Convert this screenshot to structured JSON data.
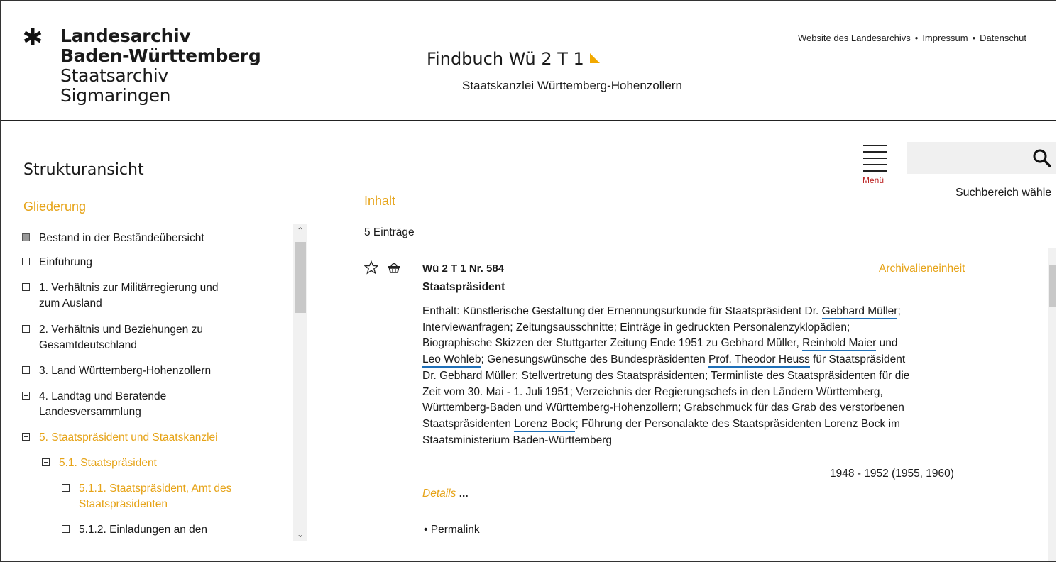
{
  "header": {
    "logo": {
      "line1": "Landesarchiv",
      "line2": "Baden-Württemberg",
      "line3": "Staatsarchiv",
      "line4": "Sigmaringen"
    },
    "title": "Findbuch Wü 2 T 1",
    "subtitle": "Staatskanzlei Württemberg-Hohenzollern",
    "links": [
      "Website des Landesarchivs",
      "Impressum",
      "Datenschut"
    ],
    "link_separator": "•"
  },
  "sidebar": {
    "heading": "Strukturansicht",
    "subheading": "Gliederung",
    "items": [
      {
        "label": "Bestand in der Beständeübersicht",
        "icon": "filled-square-icon"
      },
      {
        "label": "Einführung",
        "icon": "empty-square-icon"
      },
      {
        "label_lines": [
          "1. Verhältnis zur Militärregierung und",
          "zum Ausland"
        ],
        "icon": "expand-plus-icon"
      },
      {
        "label_lines": [
          "2. Verhältnis und Beziehungen zu",
          "Gesamtdeutschland"
        ],
        "icon": "expand-plus-icon"
      },
      {
        "label": "3. Land Württemberg-Hohenzollern",
        "icon": "expand-plus-icon"
      },
      {
        "label_lines": [
          "4. Landtag und Beratende",
          "Landesversammlung"
        ],
        "icon": "expand-plus-icon"
      },
      {
        "label": "5. Staatspräsident und Staatskanzlei",
        "icon": "collapse-minus-icon",
        "active": true
      },
      {
        "label": "5.1. Staatspräsident",
        "icon": "collapse-minus-icon",
        "active": true
      },
      {
        "label_lines": [
          "5.1.1. Staatspräsident, Amt des",
          "Staatspräsidenten"
        ],
        "icon": "empty-square-icon",
        "active": true
      },
      {
        "label": "5.1.2. Einladungen an den",
        "icon": "empty-square-icon"
      }
    ]
  },
  "toolbar": {
    "menu_label": "Menü",
    "search_placeholder": "",
    "search_scope": "Suchbereich wähle"
  },
  "content": {
    "heading": "Inhalt",
    "count": "5 Einträge",
    "entry": {
      "signature": "Wü 2 T 1 Nr. 584",
      "type": "Archivalieneinheit",
      "title": "Staatspräsident",
      "text_lines": [
        [
          "Enthält: Künstlerische Gestaltung der Ernennungsurkunde für Staatspräsident Dr. ",
          "Gebhard Müller",
          ";"
        ],
        [
          "Interviewanfragen; Zeitungsausschnitte; Einträge in gedruckten Personalenzyklopädien;"
        ],
        [
          "Biographische Skizzen der Stuttgarter Zeitung Ende 1951 zu Gebhard Müller, ",
          "Reinhold Maier",
          " und"
        ],
        [
          "",
          "Leo Wohleb",
          "; Genesungswünsche des Bundespräsidenten ",
          "Prof. Theodor Heuss",
          " für Staatspräsident"
        ],
        [
          "Dr. Gebhard Müller; Stellvertretung des Staatspräsidenten; Terminliste des Staatspräsidenten für die"
        ],
        [
          "Zeit vom 30. Mai - 1. Juli 1951; Verzeichnis der Regierungschefs in den Ländern Württemberg,"
        ],
        [
          "Württemberg-Baden und Württemberg-Hohenzollern; Grabschmuck für das Grab des verstorbenen"
        ],
        [
          "Staatspräsidenten ",
          "Lorenz Bock",
          "; Führung der Personalakte des Staatspräsidenten Lorenz Bock im"
        ],
        [
          "Staatsministerium Baden-Württemberg"
        ]
      ],
      "date": "1948 - 1952 (1955, 1960)",
      "details_label": "Details",
      "details_suffix": "...",
      "permalink": "Permalink"
    }
  }
}
